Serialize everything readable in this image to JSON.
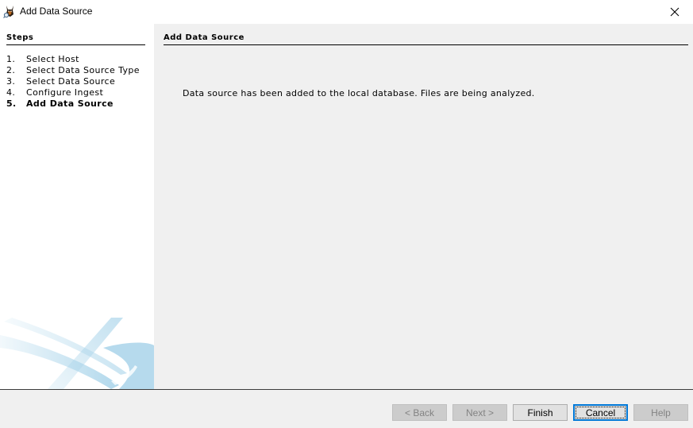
{
  "window": {
    "title": "Add Data Source",
    "icon": "autopsy-dog-icon",
    "close_icon": "close-icon"
  },
  "steps": {
    "title": "Steps",
    "items": [
      {
        "num": "1.",
        "label": "Select Host",
        "current": false
      },
      {
        "num": "2.",
        "label": "Select Data Source Type",
        "current": false
      },
      {
        "num": "3.",
        "label": "Select Data Source",
        "current": false
      },
      {
        "num": "4.",
        "label": "Configure Ingest",
        "current": false
      },
      {
        "num": "5.",
        "label": "Add Data Source",
        "current": true
      }
    ]
  },
  "content": {
    "title": "Add Data Source",
    "message": "Data source has been added to the local database. Files are being analyzed."
  },
  "buttons": {
    "back": {
      "label": "< Back",
      "enabled": false
    },
    "next": {
      "label": "Next >",
      "enabled": false
    },
    "finish": {
      "label": "Finish",
      "enabled": true
    },
    "cancel": {
      "label": "Cancel",
      "enabled": true,
      "focused": true
    },
    "help": {
      "label": "Help",
      "enabled": false
    }
  },
  "colors": {
    "focus_border": "#0078d7",
    "panel_bg": "#f0f0f0",
    "steps_bg": "#ffffff",
    "swoosh": "#a9d4ea"
  }
}
